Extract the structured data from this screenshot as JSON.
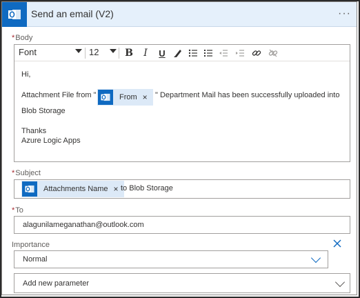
{
  "header": {
    "title": "Send an email (V2)",
    "icon": "outlook-icon",
    "more": "···"
  },
  "body_field": {
    "label": "Body",
    "required_marker": "*",
    "toolbar": {
      "font": "Font",
      "size": "12",
      "buttons": [
        "bold-icon",
        "italic-icon",
        "underline-icon",
        "highlight-pen-icon",
        "bulleted-list-icon",
        "numbered-list-icon",
        "decrease-indent-icon",
        "increase-indent-icon",
        "link-icon",
        "unlink-icon"
      ]
    },
    "content": {
      "greeting": "Hi,",
      "line_prefix": "Attachment File from \"",
      "token_label": "From",
      "line_suffix": "\"  Department Mail has been successfully uploaded into",
      "line2": "Blob Storage",
      "thanks": "Thanks",
      "signature": "Azure Logic Apps"
    }
  },
  "subject_field": {
    "label": "Subject",
    "required_marker": "*",
    "token_label": "Attachments Name",
    "suffix_text": "to Blob Storage"
  },
  "to_field": {
    "label": "To",
    "required_marker": "*",
    "value": "alagunilameganathan@outlook.com"
  },
  "importance_field": {
    "label": "Importance",
    "value": "Normal"
  },
  "add_parameter": {
    "placeholder": "Add new parameter"
  },
  "colors": {
    "accent": "#0f6ac1",
    "header_bg": "#e5f0fb",
    "token_bg": "#dce9f7",
    "required": "#a4262c"
  }
}
